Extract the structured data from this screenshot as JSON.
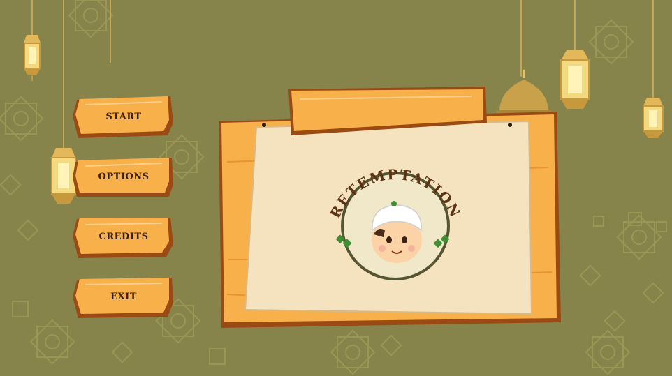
{
  "menu": {
    "start_label": "START",
    "options_label": "OPTIONS",
    "credits_label": "CREDITS",
    "exit_label": "EXIT"
  },
  "logo": {
    "title": "RETEMPTATION"
  },
  "colors": {
    "background": "#86844a",
    "wood_light": "#f7b04a",
    "wood_dark": "#9a4a12",
    "parchment": "#f5e3bf",
    "logo_text": "#5b3214"
  },
  "icons": {
    "lantern": "lantern-icon",
    "dome": "mosque-dome-icon",
    "mascot": "boy-with-kufi-cap",
    "ketupat": "ketupat-icon"
  }
}
